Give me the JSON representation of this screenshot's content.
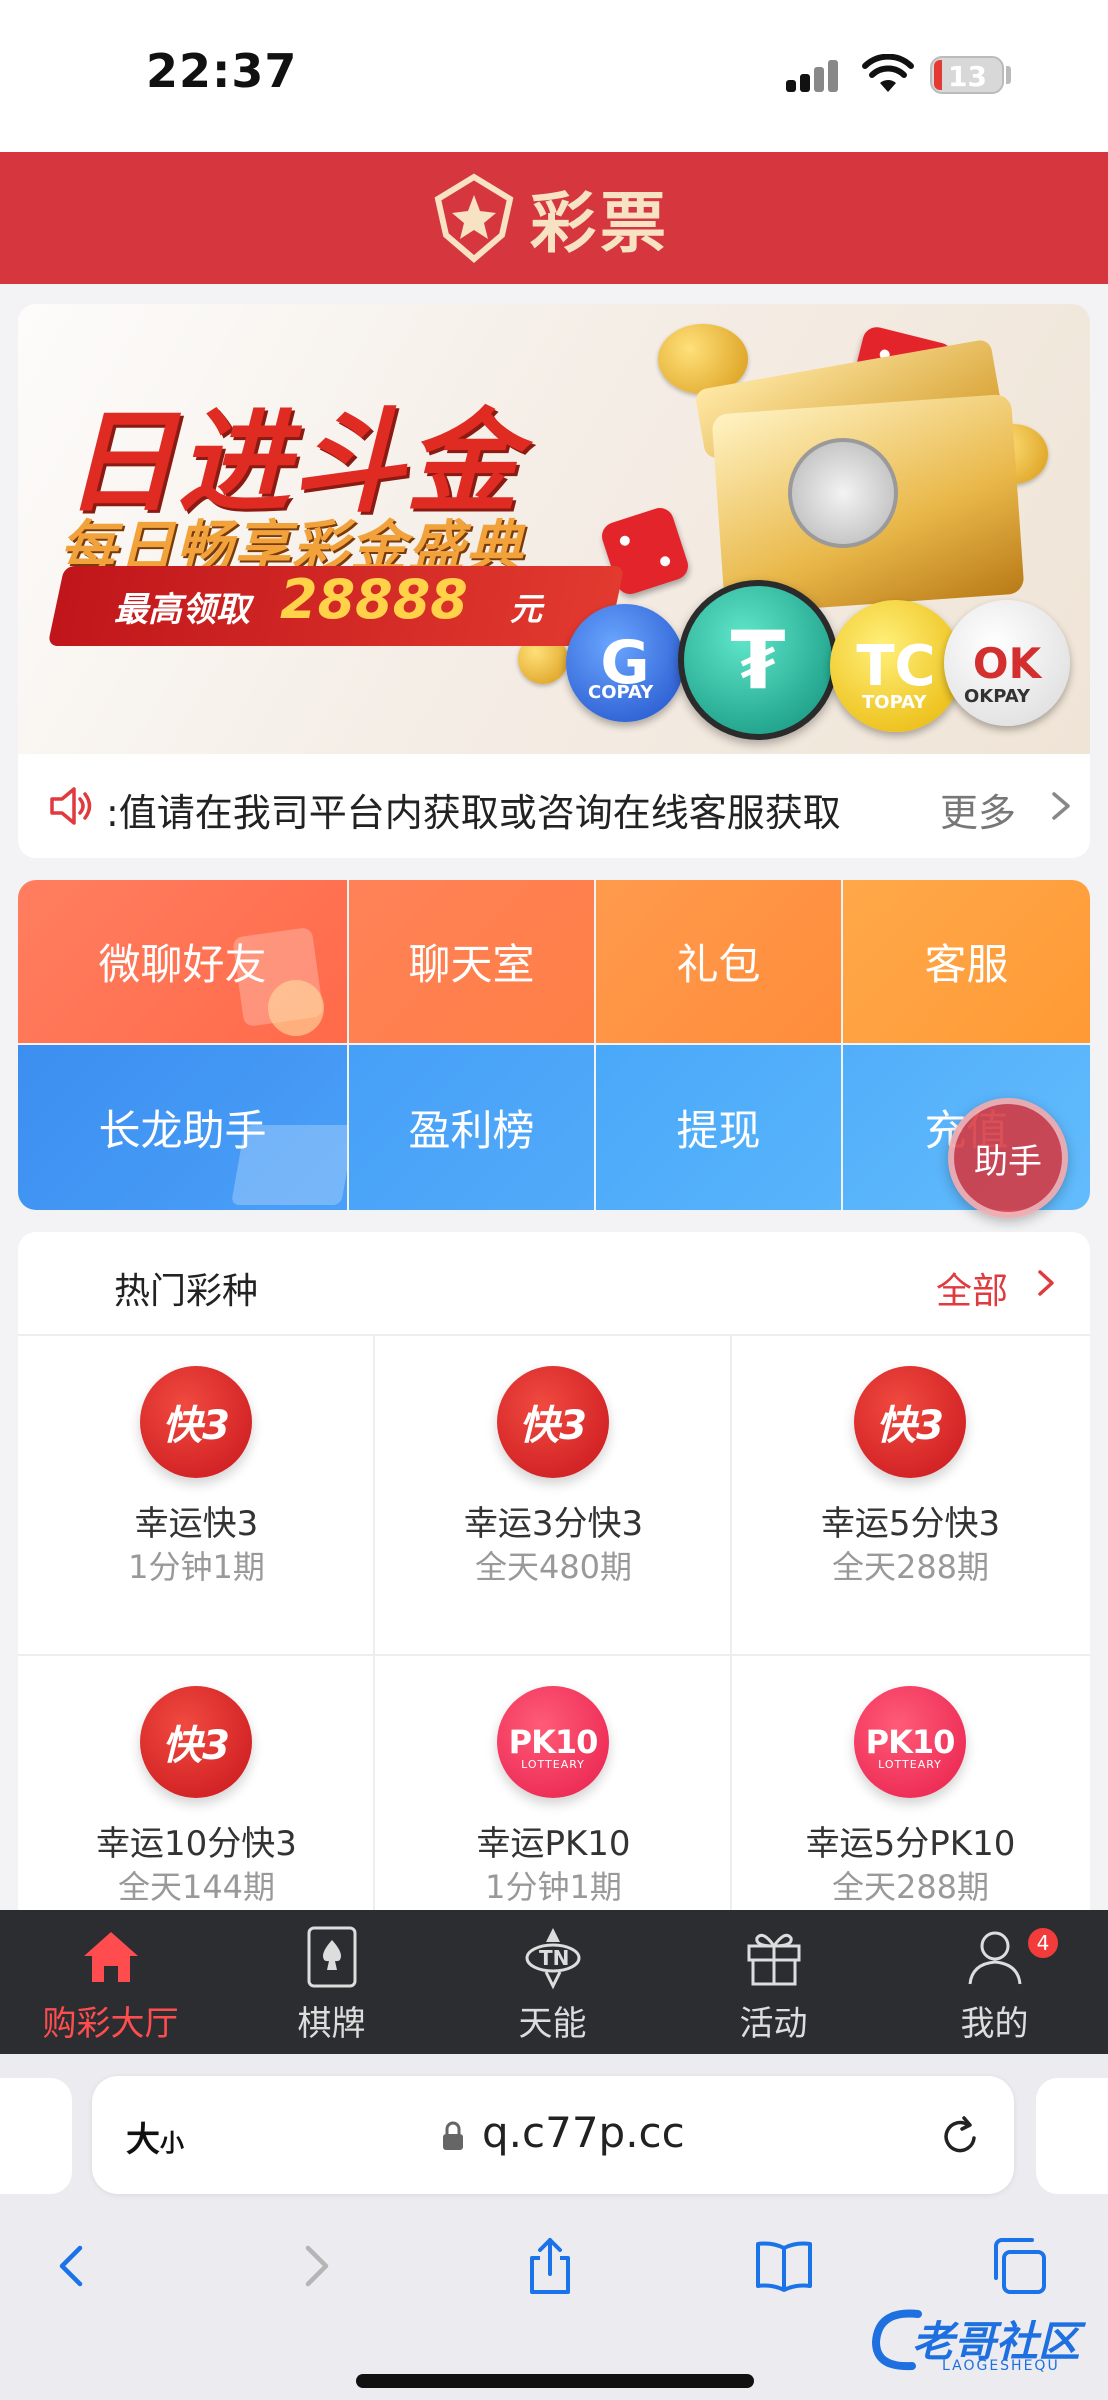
{
  "status_bar": {
    "time": "22:37",
    "battery": "13"
  },
  "header": {
    "brand": "彩票"
  },
  "banner": {
    "headline": "日进斗金",
    "subline": "每日畅享彩金盛典",
    "promo_label": "最高领取",
    "promo_amount": "28888",
    "promo_unit": "元",
    "coin_labels": [
      "COPAY",
      "TOPAY",
      "OKPAY"
    ]
  },
  "notice": {
    "text": ":值请在我司平台内获取或咨询在线客服获取",
    "more": "更多"
  },
  "quick_menu": {
    "items": [
      "微聊好友",
      "聊天室",
      "礼包",
      "客服",
      "长龙助手",
      "盈利榜",
      "提现",
      "充值"
    ],
    "helper": "助手"
  },
  "hot": {
    "title": "热门彩种",
    "all": "全部",
    "games": [
      {
        "name": "幸运快3",
        "sub": "1分钟1期",
        "icon": "kuai3-icon"
      },
      {
        "name": "幸运3分快3",
        "sub": "全天480期",
        "icon": "kuai3-icon"
      },
      {
        "name": "幸运5分快3",
        "sub": "全天288期",
        "icon": "kuai3-icon"
      },
      {
        "name": "幸运10分快3",
        "sub": "全天144期",
        "icon": "kuai3-icon"
      },
      {
        "name": "幸运PK10",
        "sub": "1分钟1期",
        "icon": "pk10-icon"
      },
      {
        "name": "幸运5分PK10",
        "sub": "全天288期",
        "icon": "pk10-icon"
      }
    ],
    "icon_text": {
      "k3": "快3",
      "pk": "PK10",
      "pk_sub": "LOTTEARY"
    }
  },
  "tabbar": {
    "tabs": [
      "购彩大厅",
      "棋牌",
      "天能",
      "活动",
      "我的"
    ],
    "badge": "4",
    "active_color": "#ff4d4f"
  },
  "browser": {
    "text_size": "大",
    "text_size_small": "小",
    "url": "q.c77p.cc"
  },
  "watermark": {
    "text": "老哥社区",
    "sub": "LAOGESHEQU"
  },
  "colors": {
    "brand_red": "#d6373f",
    "orange": "#ff8a45",
    "blue": "#4aa0f8"
  }
}
